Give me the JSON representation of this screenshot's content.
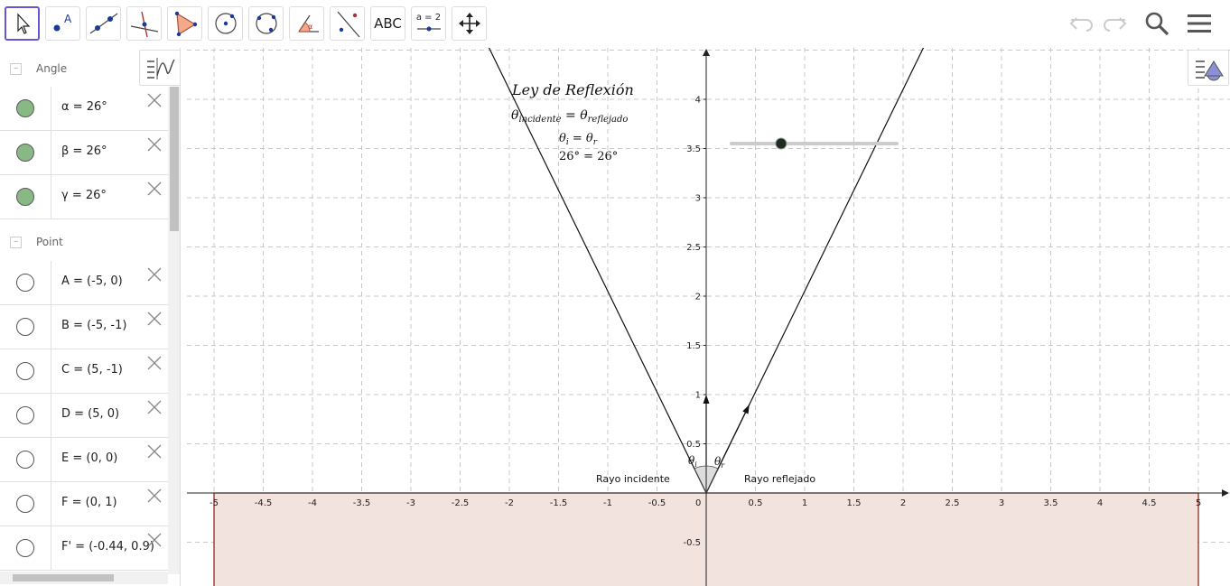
{
  "toolbar": {
    "tools": [
      "move-tool",
      "point-tool",
      "line-tool",
      "perpendicular-line-tool",
      "polygon-tool",
      "circle-center-point-tool",
      "circle-three-points-tool",
      "angle-tool",
      "reflect-tool",
      "text-tool",
      "slider-tool",
      "move-graphics-view-tool"
    ],
    "text_tool_label": "ABC",
    "slider_tool_label": "a = 2",
    "right": [
      "undo-icon",
      "redo-icon",
      "search-icon",
      "menu-icon"
    ]
  },
  "algebra": {
    "groups": [
      {
        "title": "Angle",
        "items": [
          {
            "expr": "α = 26°",
            "visible": true
          },
          {
            "expr": "β = 26°",
            "visible": true
          },
          {
            "expr": "γ = 26°",
            "visible": true
          }
        ]
      },
      {
        "title": "Point",
        "items": [
          {
            "expr": "A = (-5, 0)",
            "visible": false
          },
          {
            "expr": "B = (-5, -1)",
            "visible": false
          },
          {
            "expr": "C = (5, -1)",
            "visible": false
          },
          {
            "expr": "D = (5, 0)",
            "visible": false
          },
          {
            "expr": "E = (0, 0)",
            "visible": false
          },
          {
            "expr": "F = (0, 1)",
            "visible": false
          },
          {
            "expr": "F' = (-0.44, 0.9)",
            "visible": false
          }
        ]
      }
    ]
  },
  "graphics": {
    "x_ticks": [
      "-5",
      "-4.5",
      "-4",
      "-3.5",
      "-3",
      "-2.5",
      "-2",
      "-1.5",
      "-1",
      "-0.5",
      "0",
      "0.5",
      "1",
      "1.5",
      "2",
      "2.5",
      "3",
      "3.5",
      "4",
      "4.5",
      "5"
    ],
    "y_ticks": [
      "-0.5",
      "0.5",
      "1",
      "1.5",
      "2",
      "2.5",
      "3",
      "3.5",
      "4"
    ],
    "title": "Ley de Reflexión",
    "law_main": "θ",
    "law_sub_left": "incidente",
    "law_eq": " = θ",
    "law_sub_right": "reflejado",
    "eq1": "θ",
    "eq1_sub_i": "i",
    "eq1_mid": " = θ",
    "eq1_sub_r": "r",
    "eq2": "26° = 26°",
    "label_incident": "Rayo incidente",
    "label_reflected": "Rayo reflejado",
    "theta_i": "θ",
    "theta_i_sub": "i",
    "theta_r": "θ",
    "theta_r_sub": "r",
    "slider_value": 0.3,
    "colors": {
      "surface_fill": "#f2e3df",
      "surface_stroke": "#8b2c1e",
      "slider_track": "#cccccc",
      "slider_knob": "#1f2d1f",
      "angle_marble": "#88b884",
      "active_tool": "#6557d2"
    }
  }
}
